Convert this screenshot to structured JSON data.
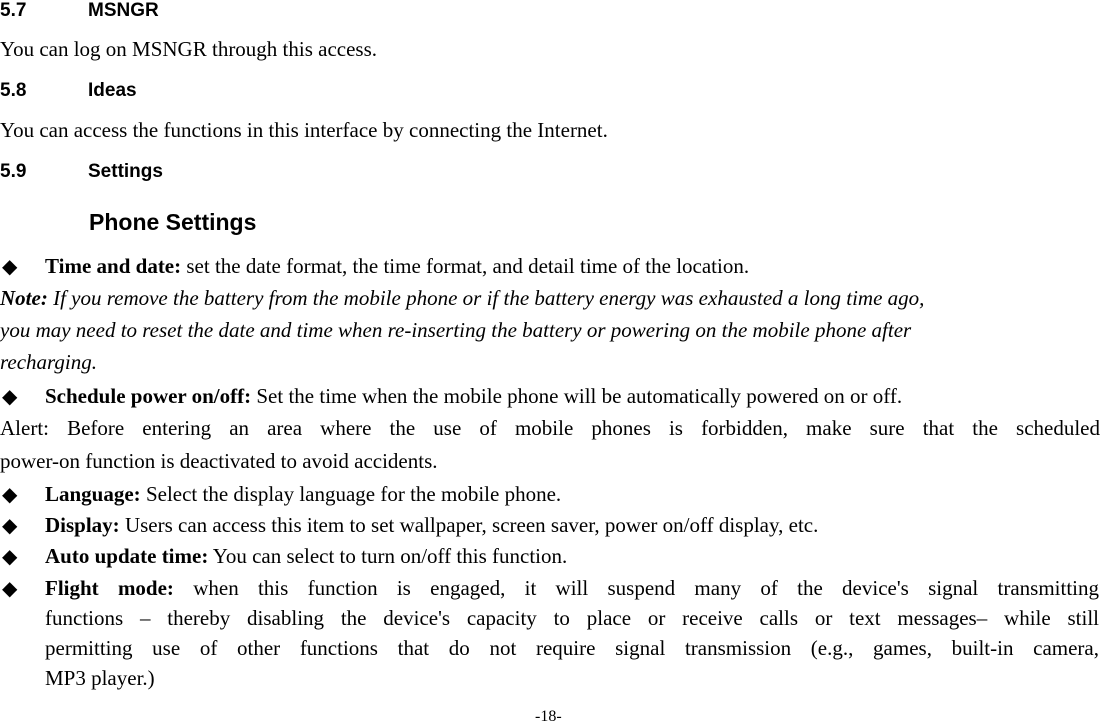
{
  "sections": [
    {
      "number": "5.7",
      "title": "MSNGR",
      "body": "You can log on MSNGR through this access."
    },
    {
      "number": "5.8",
      "title": "Ideas",
      "body": "You can access the functions in this interface by connecting the Internet."
    },
    {
      "number": "5.9",
      "title": "Settings"
    }
  ],
  "subsection": {
    "title": "Phone Settings"
  },
  "bullet_icon": "black-diamond",
  "items": {
    "time_date": {
      "label": "Time and date:",
      "text": " set the date format, the time format, and detail time of the location."
    },
    "note": {
      "label": "Note:",
      "line1": " If you remove the battery from the mobile phone or if the battery energy was exhausted a long time ago,",
      "line2": "you may need to reset the date and time when re-inserting the battery or powering on the mobile phone after",
      "line3": "recharging."
    },
    "schedule": {
      "label": "Schedule power on/off:",
      "text": " Set the time when the mobile phone will be automatically powered on or off."
    },
    "alert": {
      "line1": "Alert: Before entering an area where the use of mobile phones is forbidden, make sure that the scheduled",
      "line2": "power-on function is deactivated to avoid accidents."
    },
    "language": {
      "label": "Language:",
      "text": " Select the display language for the mobile phone."
    },
    "display": {
      "label": "Display:",
      "text": " Users can access this item to set wallpaper, screen saver, power on/off display, etc."
    },
    "auto_update": {
      "label": "Auto update time:",
      "text": " You can select to turn on/off this function."
    },
    "flight": {
      "label": "Flight mode:",
      "line1": " when this function is engaged, it will suspend many of the device's signal transmitting",
      "line2": "functions – thereby disabling the device's capacity to place or receive calls or text messages– while still",
      "line3": "permitting use of other functions that do not require signal transmission (e.g., games, built-in camera,",
      "line4": "MP3 player.)"
    }
  },
  "footer": {
    "page_number": "-18-"
  }
}
